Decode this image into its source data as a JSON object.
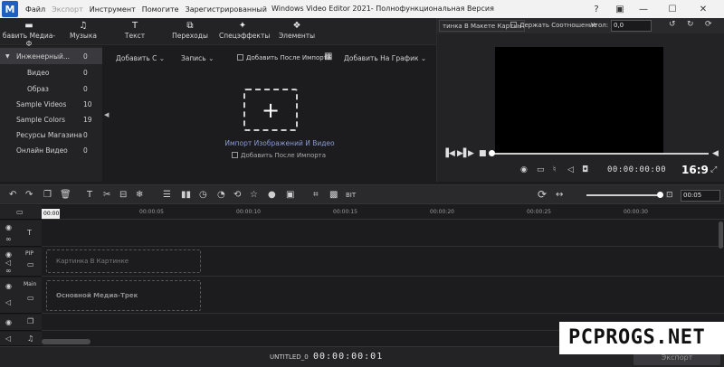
{
  "titlebar": {
    "logo_glyph": "M",
    "title": "Windows Video Editor 2021- Полнофункциональная Версия",
    "menu": [
      {
        "label": "Файл",
        "disabled": false
      },
      {
        "label": "Экспорт",
        "disabled": true
      },
      {
        "label": "Инструмент",
        "disabled": false
      },
      {
        "label": "Помогите",
        "disabled": false
      },
      {
        "label": "Зарегистрированный",
        "disabled": false
      }
    ]
  },
  "top_toolbar": [
    {
      "label": "бавить Медиа-Ф",
      "icon": "folder-icon"
    },
    {
      "label": "Музыка",
      "icon": "music-icon"
    },
    {
      "label": "Текст",
      "icon": "text-icon"
    },
    {
      "label": "Переходы",
      "icon": "transitions-icon"
    },
    {
      "label": "Спецэффекты",
      "icon": "effects-icon"
    },
    {
      "label": "Элементы",
      "icon": "elements-icon"
    }
  ],
  "tree": [
    {
      "label": "Инженерный...",
      "count": "0",
      "active": true
    },
    {
      "label": "Видео",
      "count": "0",
      "active": false
    },
    {
      "label": "Образ",
      "count": "0",
      "active": false
    },
    {
      "label": "Sample Videos",
      "count": "10",
      "active": false
    },
    {
      "label": "Sample Colors",
      "count": "19",
      "active": false
    },
    {
      "label": "Ресурсы Магазина",
      "count": "0",
      "active": false
    },
    {
      "label": "Онлайн Видео",
      "count": "0",
      "active": false
    }
  ],
  "media": {
    "add_label": "Добавить С",
    "record_label": "Запись",
    "add_after_import": "Добавить После Импорта",
    "add_to_timeline": "Добавить На График",
    "import_label": "Импорт Изображений И Видео",
    "import_check_label": "Добавить После Импорта"
  },
  "preview": {
    "mode": "тинка В Макете Картин",
    "keep_ratio": "Держать Соотношение",
    "angle_label": "Угол:",
    "angle_value": "0,0",
    "time": "00:00:00:00",
    "ratio": "16:9"
  },
  "edit_toolbar": {
    "zoom_value": "00:05"
  },
  "timeline": {
    "playhead": "00:00",
    "ticks": [
      "00:00:05",
      "00:00:10",
      "00:00:15",
      "00:00:20",
      "00:00:25",
      "00:00:30"
    ],
    "tracks": {
      "pip_label": "PIP",
      "main_label": "Main",
      "pip_slot": "Картинка В Картинке",
      "main_slot": "Основной Медиа-Трек"
    }
  },
  "statusbar": {
    "project": "UNTITLED_0",
    "time": "00:00:00:01",
    "export": "Экспорт"
  },
  "watermark": "PCPROGS.NET"
}
